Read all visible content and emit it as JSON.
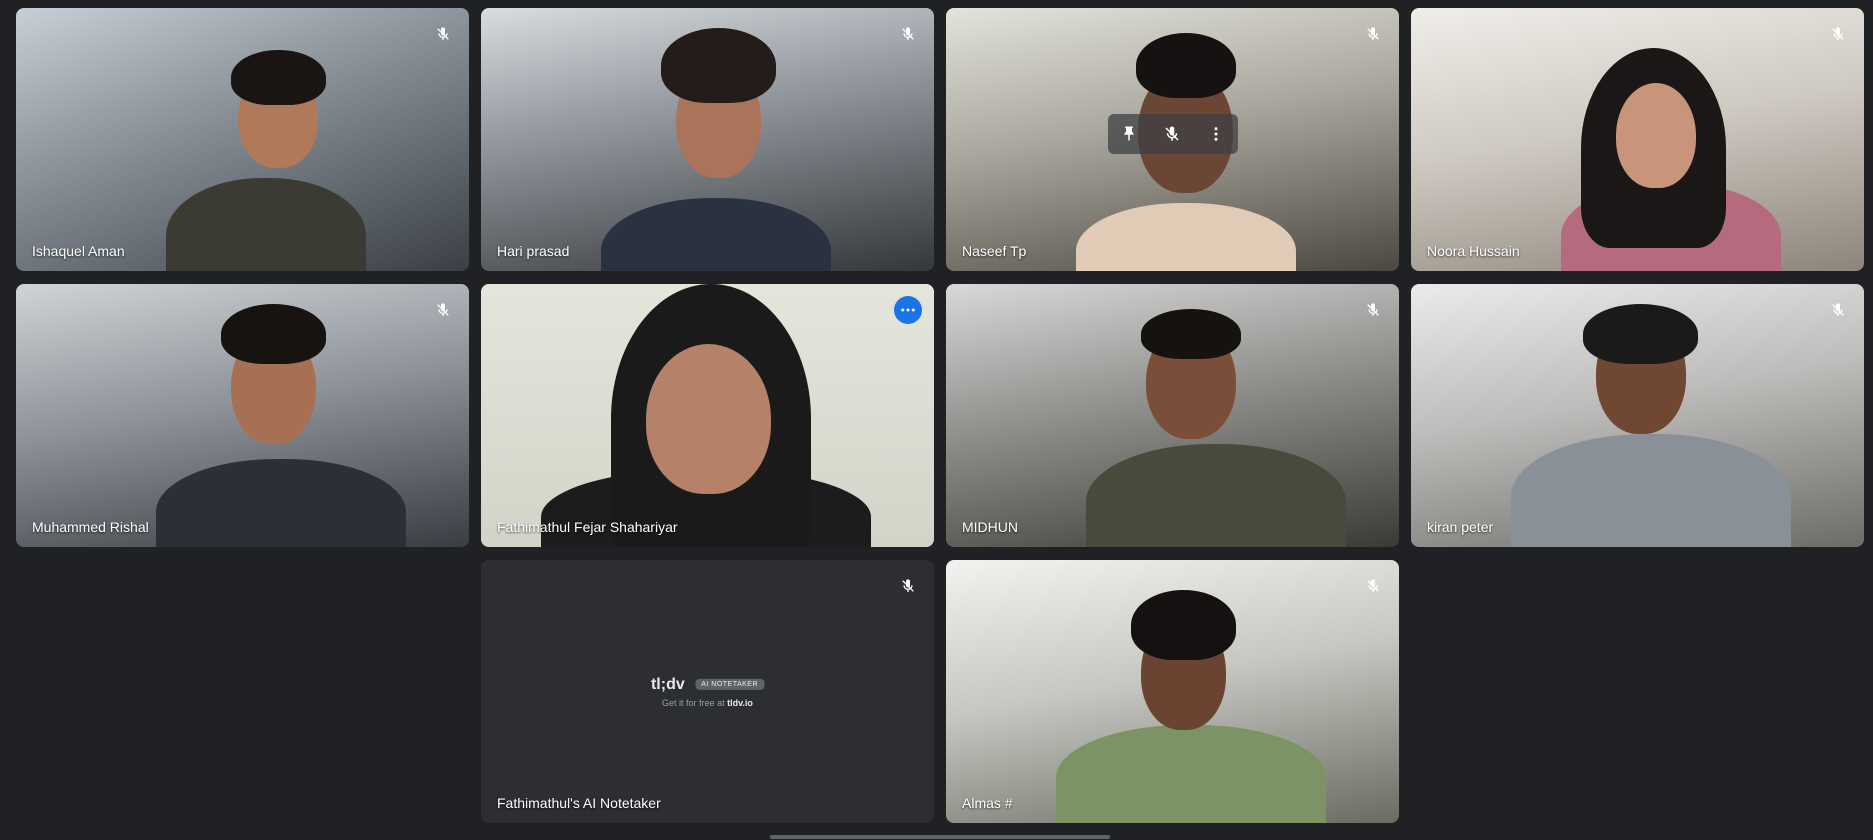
{
  "participants": [
    {
      "name": "Ishaquel Aman",
      "muted": true
    },
    {
      "name": "Hari prasad",
      "muted": true
    },
    {
      "name": "Naseef Tp",
      "muted": true
    },
    {
      "name": "Noora Hussain",
      "muted": true
    },
    {
      "name": "Muhammed Rishal",
      "muted": true
    },
    {
      "name": "Fathimathul Fejar Shahariyar",
      "muted": false,
      "active": true
    },
    {
      "name": "MIDHUN",
      "muted": true
    },
    {
      "name": "kiran peter",
      "muted": true
    },
    {
      "name": "Fathimathul's AI Notetaker",
      "muted": true
    },
    {
      "name": "Almas #",
      "muted": true
    }
  ],
  "notetaker": {
    "logo": "tl;dv",
    "tag": "AI NOTETAKER",
    "sub_prefix": "Get it for free at",
    "sub_link": "tldv.io"
  },
  "colors": {
    "background": "#202124",
    "active_border": "#8ab4f8",
    "more_button": "#1a73e8"
  },
  "icons": {
    "mute": "mic-off-icon",
    "pin": "pin-icon",
    "more": "more-options-icon"
  }
}
